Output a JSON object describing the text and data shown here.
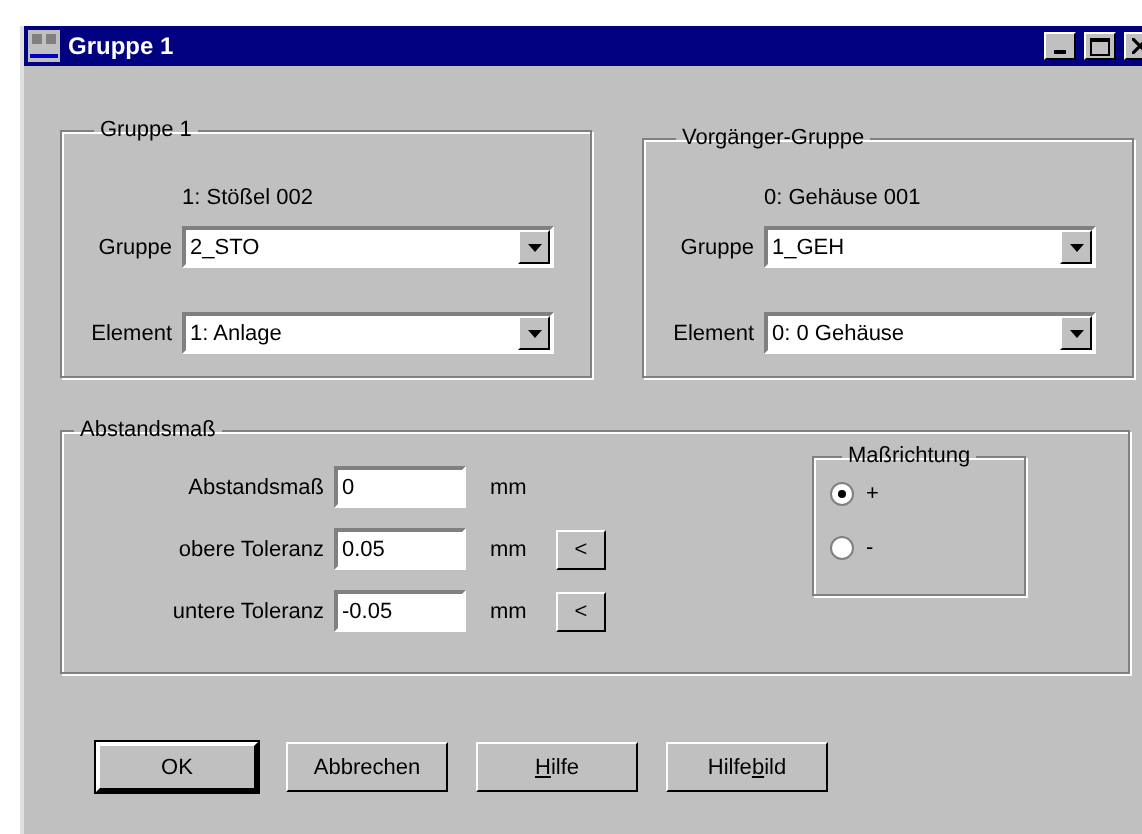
{
  "window": {
    "title": "Gruppe 1"
  },
  "groups": [
    {
      "title": "Gruppe 1",
      "caption": "1: Stößel 002",
      "fields": [
        {
          "label": "Gruppe",
          "value": "2_STO"
        },
        {
          "label": "Element",
          "value": "1: Anlage"
        }
      ]
    },
    {
      "title": "Vorgänger-Gruppe",
      "caption": "0: Gehäuse 001",
      "fields": [
        {
          "label": "Gruppe",
          "value": "1_GEH"
        },
        {
          "label": "Element",
          "value": "0: 0 Gehäuse"
        }
      ]
    }
  ],
  "distance": {
    "title": "Abstandsmaß",
    "rows": [
      {
        "label": "Abstandsmaß",
        "value": "0",
        "unit": "mm"
      },
      {
        "label": "obere Toleranz",
        "value": "0.05",
        "unit": "mm",
        "button": "<"
      },
      {
        "label": "untere Toleranz",
        "value": "-0.05",
        "unit": "mm",
        "button": "<"
      }
    ],
    "direction": {
      "title": "Maßrichtung",
      "options": [
        {
          "label": "+",
          "selected": true
        },
        {
          "label": "-",
          "selected": false
        }
      ]
    }
  },
  "buttons": [
    {
      "before": "OK",
      "default": true
    },
    {
      "before": "Abbrechen",
      "default": false
    },
    {
      "mnemonic": "H",
      "after": "ilfe",
      "default": false
    },
    {
      "before": "Hilfe",
      "mnemonic": "b",
      "after": "ild",
      "default": false
    }
  ]
}
